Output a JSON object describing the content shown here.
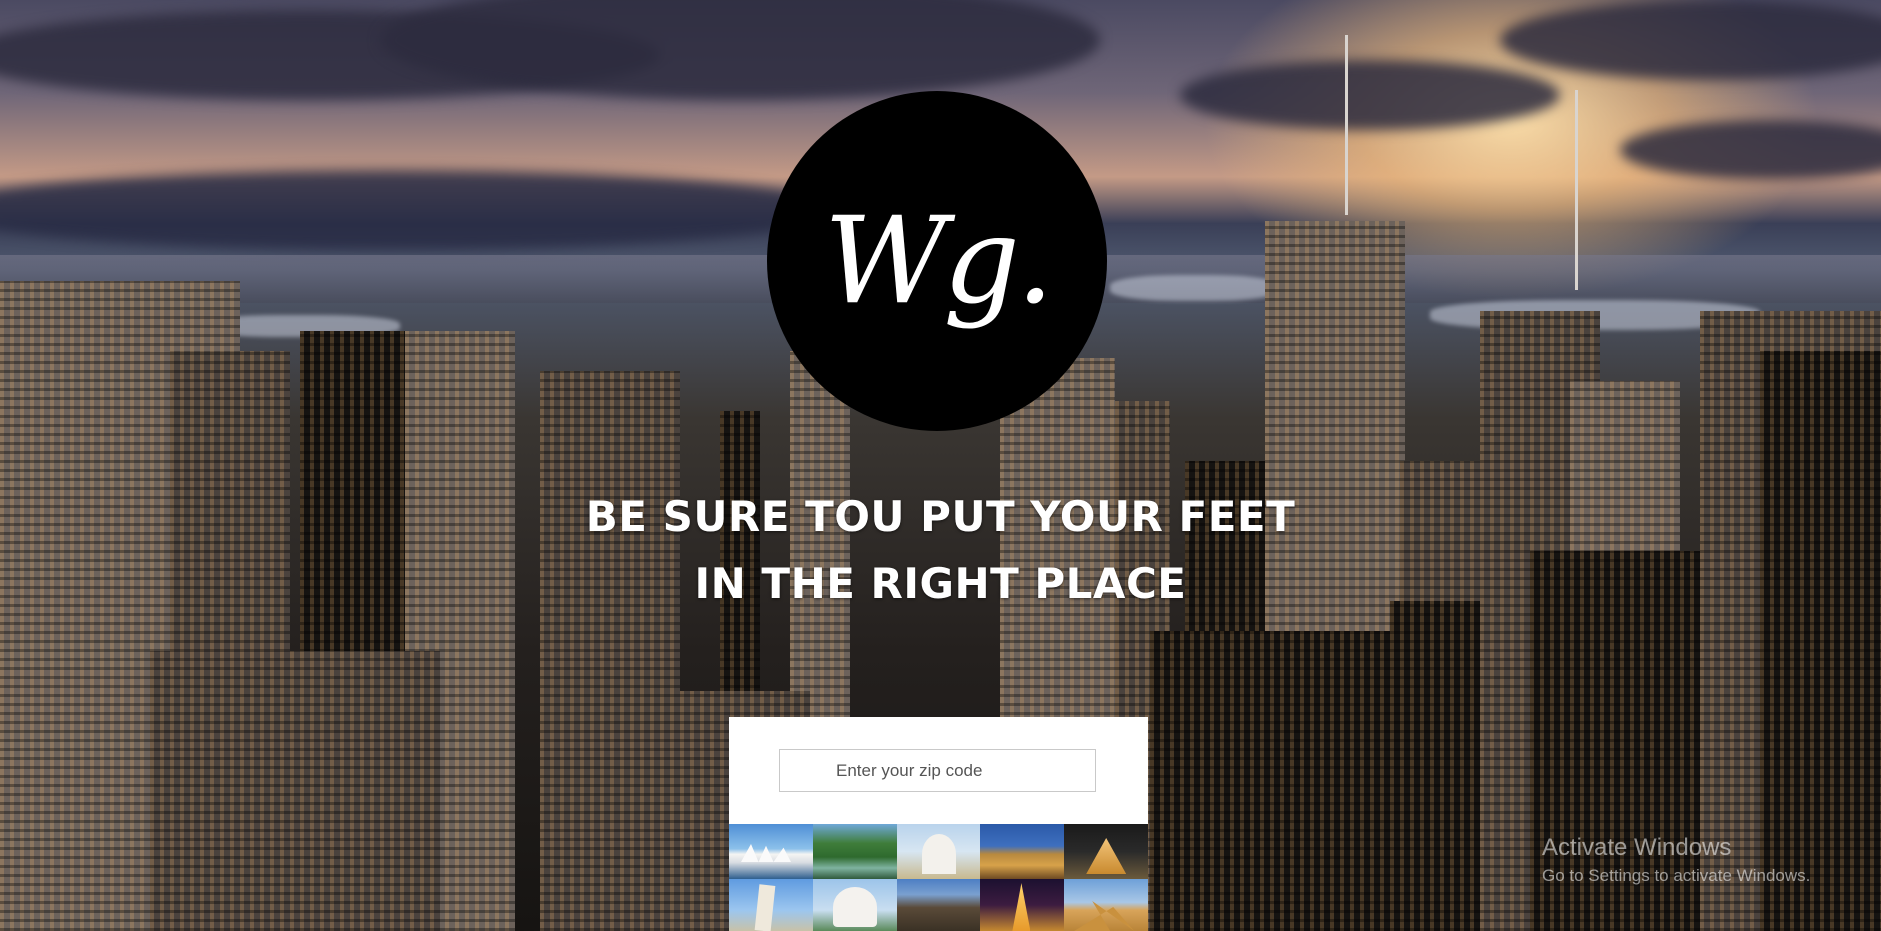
{
  "logo": {
    "text": "Wg."
  },
  "hero": {
    "line1": "BE SURE TOU PUT YOUR FEET",
    "line2": "IN THE RIGHT PLACE"
  },
  "search": {
    "placeholder": "Enter your zip code",
    "value": ""
  },
  "tiles": [
    {
      "name": "sydney-opera-house-icon"
    },
    {
      "name": "river-landscape-icon"
    },
    {
      "name": "sacre-coeur-icon"
    },
    {
      "name": "colosseum-icon"
    },
    {
      "name": "louvre-pyramid-icon"
    },
    {
      "name": "leaning-tower-icon"
    },
    {
      "name": "taj-mahal-icon"
    },
    {
      "name": "grand-canyon-icon"
    },
    {
      "name": "eiffel-tower-icon"
    },
    {
      "name": "pyramids-icon"
    }
  ],
  "watermark": {
    "title": "Activate Windows",
    "subtitle": "Go to Settings to activate Windows."
  }
}
